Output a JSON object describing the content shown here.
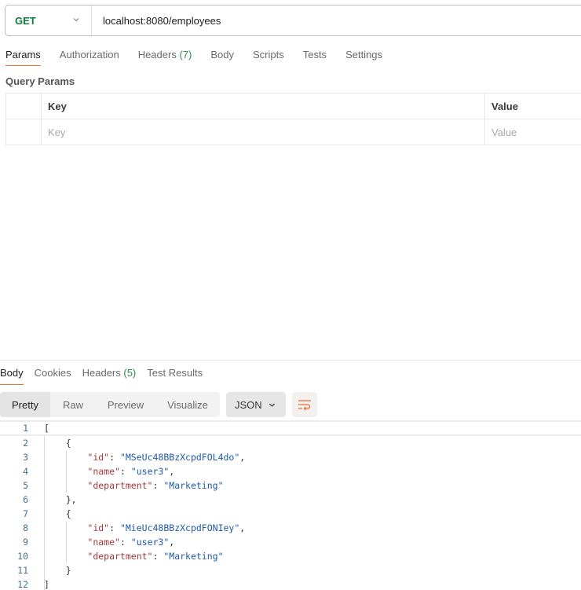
{
  "request": {
    "method": "GET",
    "url": "localhost:8080/employees",
    "tabs": [
      {
        "label": "Params",
        "active": true
      },
      {
        "label": "Authorization"
      },
      {
        "label": "Headers",
        "count": "(7)"
      },
      {
        "label": "Body"
      },
      {
        "label": "Scripts"
      },
      {
        "label": "Tests"
      },
      {
        "label": "Settings"
      }
    ],
    "query_params": {
      "title": "Query Params",
      "columns": [
        "Key",
        "Value"
      ],
      "placeholders": {
        "key": "Key",
        "value": "Value"
      }
    }
  },
  "response": {
    "tabs": [
      {
        "label": "Body",
        "active": true
      },
      {
        "label": "Cookies"
      },
      {
        "label": "Headers",
        "count": "(5)"
      },
      {
        "label": "Test Results"
      }
    ],
    "views": [
      "Pretty",
      "Raw",
      "Preview",
      "Visualize"
    ],
    "active_view": "Pretty",
    "format": "JSON",
    "icons": {
      "format_chevron": "chevron-down-icon",
      "wrap": "wrap-lines-icon",
      "method_chevron": "chevron-down-icon"
    },
    "accent_color": "#e8703c",
    "body_lines": [
      {
        "n": "1",
        "indent": 0,
        "text": "["
      },
      {
        "n": "2",
        "indent": 1,
        "text": "{"
      },
      {
        "n": "3",
        "indent": 2,
        "key": "id",
        "value": "MSeUc48BBzXcpdFOL4do",
        "comma": true
      },
      {
        "n": "4",
        "indent": 2,
        "key": "name",
        "value": "user3",
        "comma": true
      },
      {
        "n": "5",
        "indent": 2,
        "key": "department",
        "value": "Marketing",
        "comma": false
      },
      {
        "n": "6",
        "indent": 1,
        "text": "},"
      },
      {
        "n": "7",
        "indent": 1,
        "text": "{"
      },
      {
        "n": "8",
        "indent": 2,
        "key": "id",
        "value": "MieUc48BBzXcpdFONIey",
        "comma": true
      },
      {
        "n": "9",
        "indent": 2,
        "key": "name",
        "value": "user3",
        "comma": true
      },
      {
        "n": "10",
        "indent": 2,
        "key": "department",
        "value": "Marketing",
        "comma": false
      },
      {
        "n": "11",
        "indent": 1,
        "text": "}"
      },
      {
        "n": "12",
        "indent": 0,
        "text": "]"
      }
    ]
  }
}
